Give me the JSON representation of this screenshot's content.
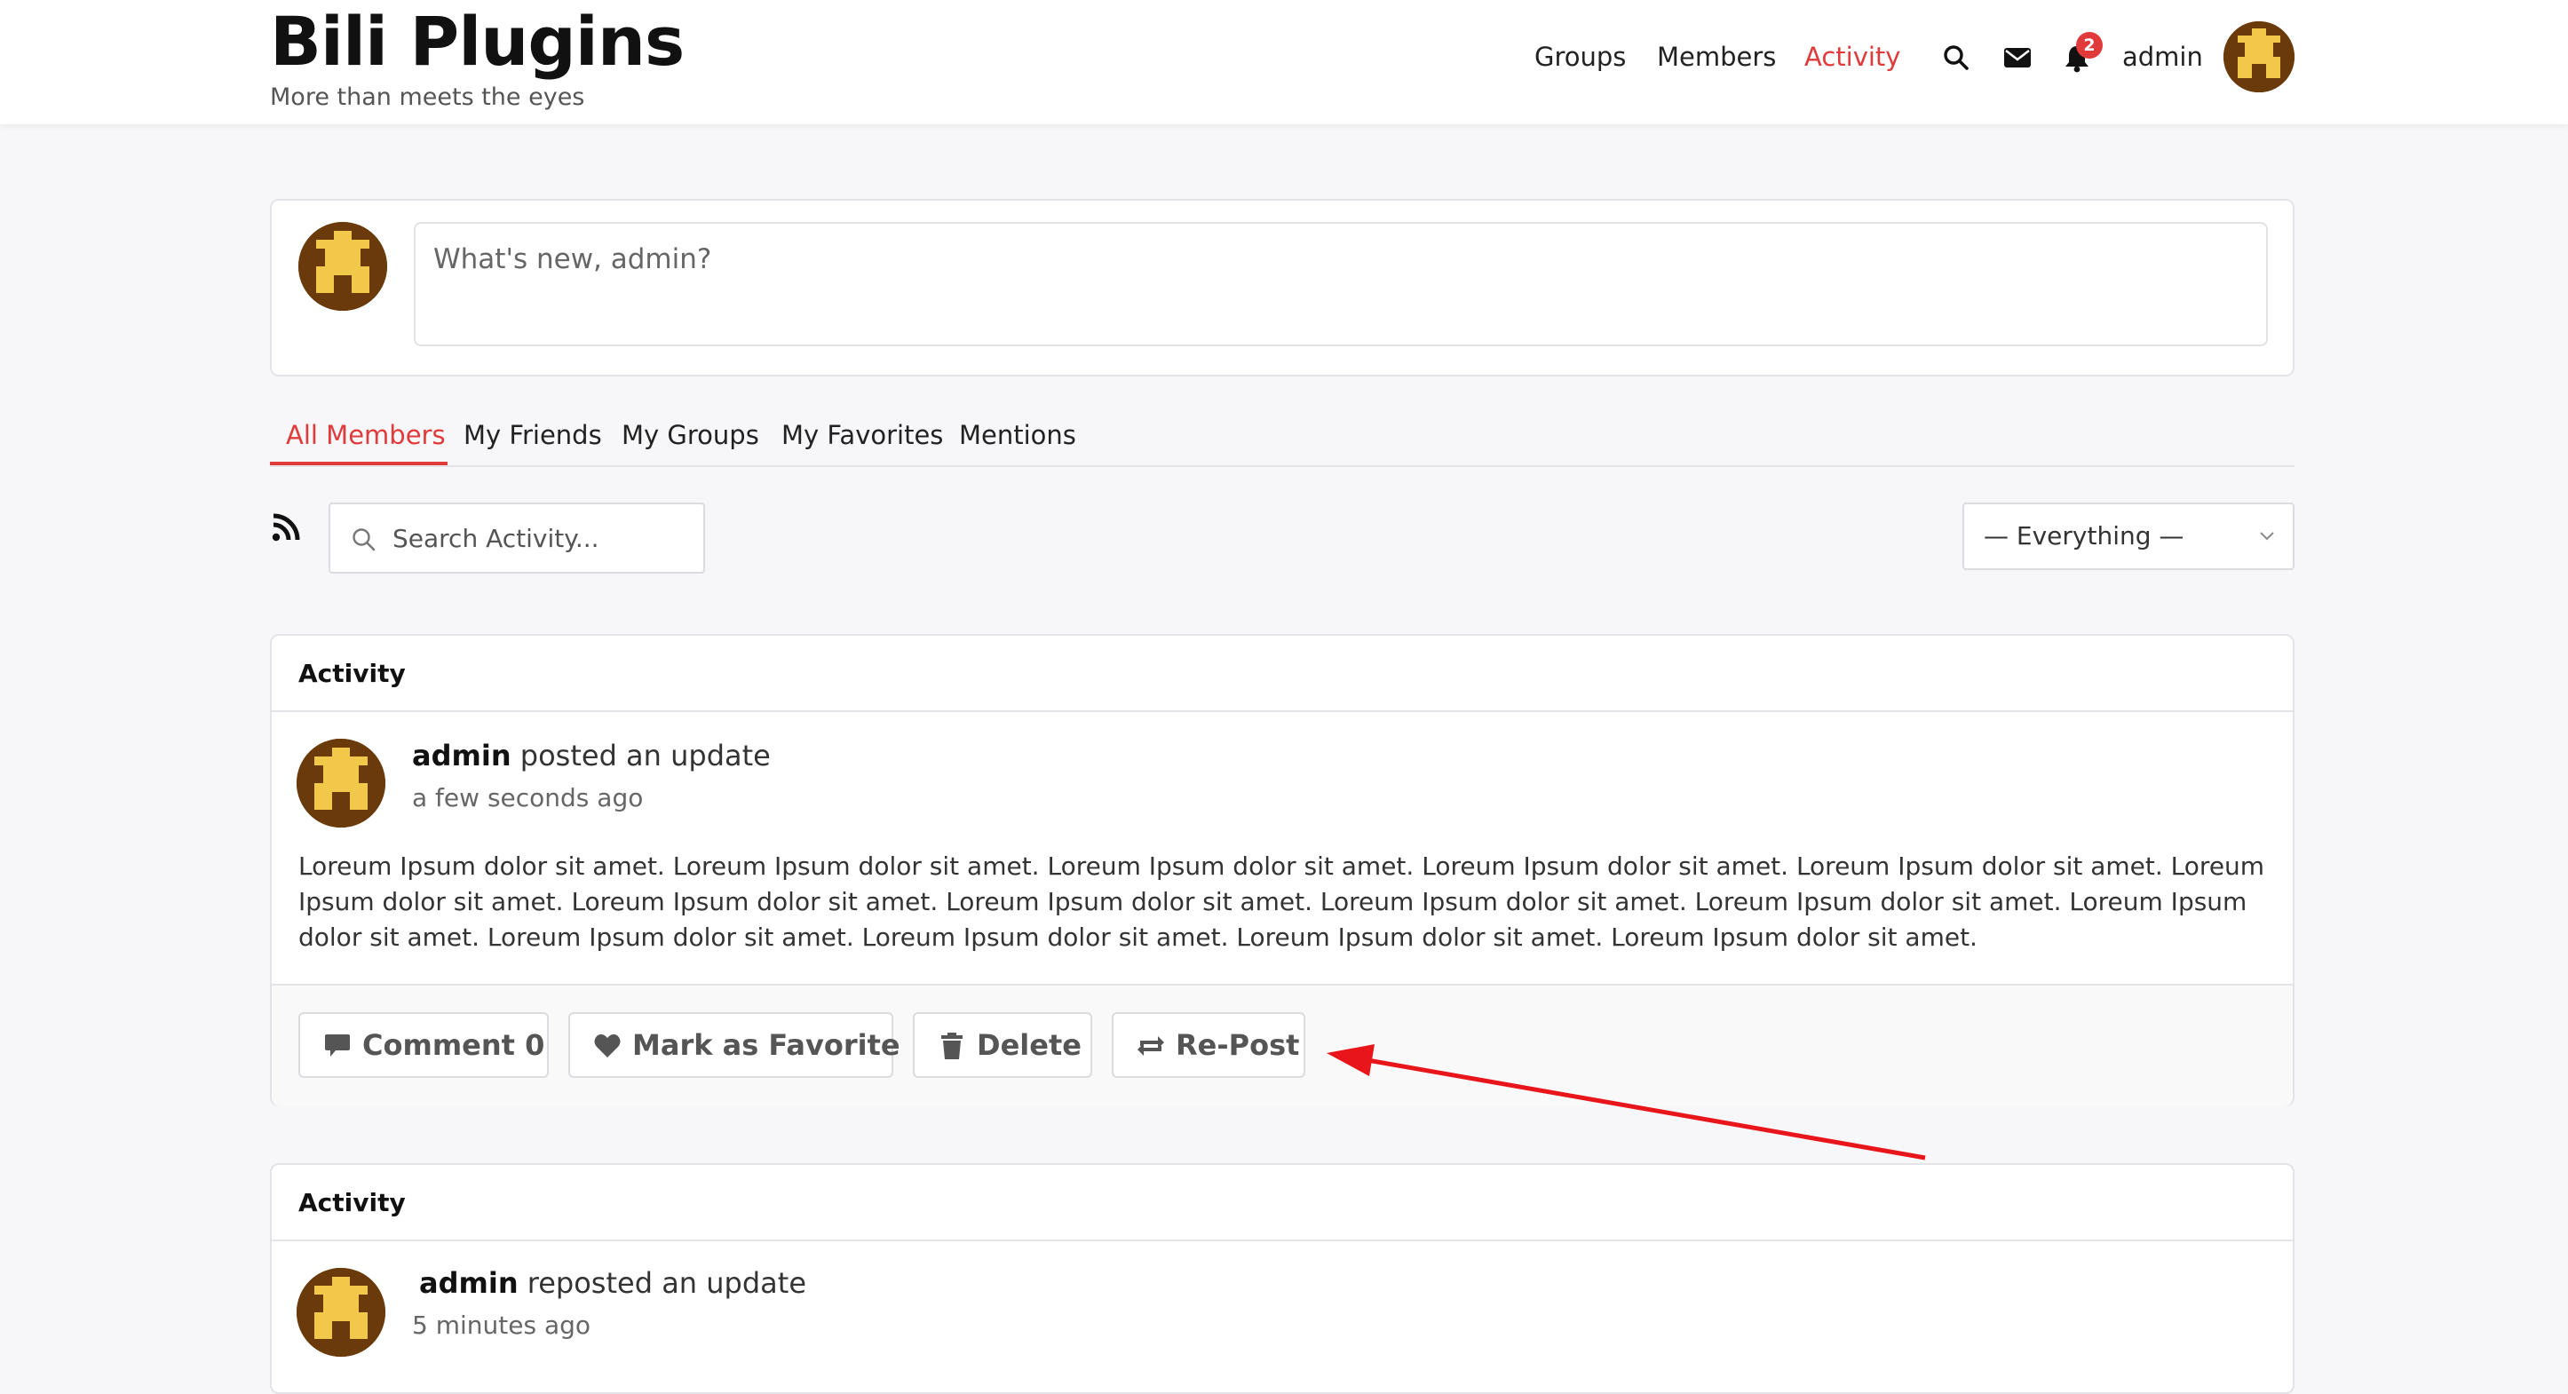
{
  "site": {
    "title": "Bili Plugins",
    "tagline": "More than meets the eyes"
  },
  "nav": {
    "links": [
      "Groups",
      "Members",
      "Activity"
    ],
    "active": "Activity",
    "notification_count": "2",
    "user": "admin"
  },
  "post_box": {
    "placeholder": "What's new, admin?"
  },
  "tabs": [
    "All Members",
    "My Friends",
    "My Groups",
    "My Favorites",
    "Mentions"
  ],
  "search": {
    "placeholder": "Search Activity..."
  },
  "filter": {
    "selected": "— Everything —"
  },
  "activities": [
    {
      "header": "Activity",
      "user": "admin",
      "action": "posted an update",
      "time": "a few seconds ago",
      "body": "Loreum Ipsum dolor sit amet. Loreum Ipsum dolor sit amet. Loreum Ipsum dolor sit amet. Loreum Ipsum dolor sit amet. Loreum Ipsum dolor sit amet. Loreum Ipsum dolor sit amet. Loreum Ipsum dolor sit amet. Loreum Ipsum dolor sit amet. Loreum Ipsum dolor sit amet. Loreum Ipsum dolor sit amet. Loreum Ipsum dolor sit amet. Loreum Ipsum dolor sit amet. Loreum Ipsum dolor sit amet. Loreum Ipsum dolor sit amet. Loreum Ipsum dolor sit amet.",
      "buttons": {
        "comment": "Comment 0",
        "favorite": "Mark as Favorite",
        "delete": "Delete",
        "repost": "Re-Post"
      }
    },
    {
      "header": "Activity",
      "user": "admin",
      "action": "reposted an update",
      "time": "5 minutes ago"
    }
  ],
  "colors": {
    "accent": "#e13a3a",
    "avatar_bg": "#6a3a0a",
    "avatar_fg": "#f2c84b",
    "annotation_arrow": "#e8151b"
  }
}
